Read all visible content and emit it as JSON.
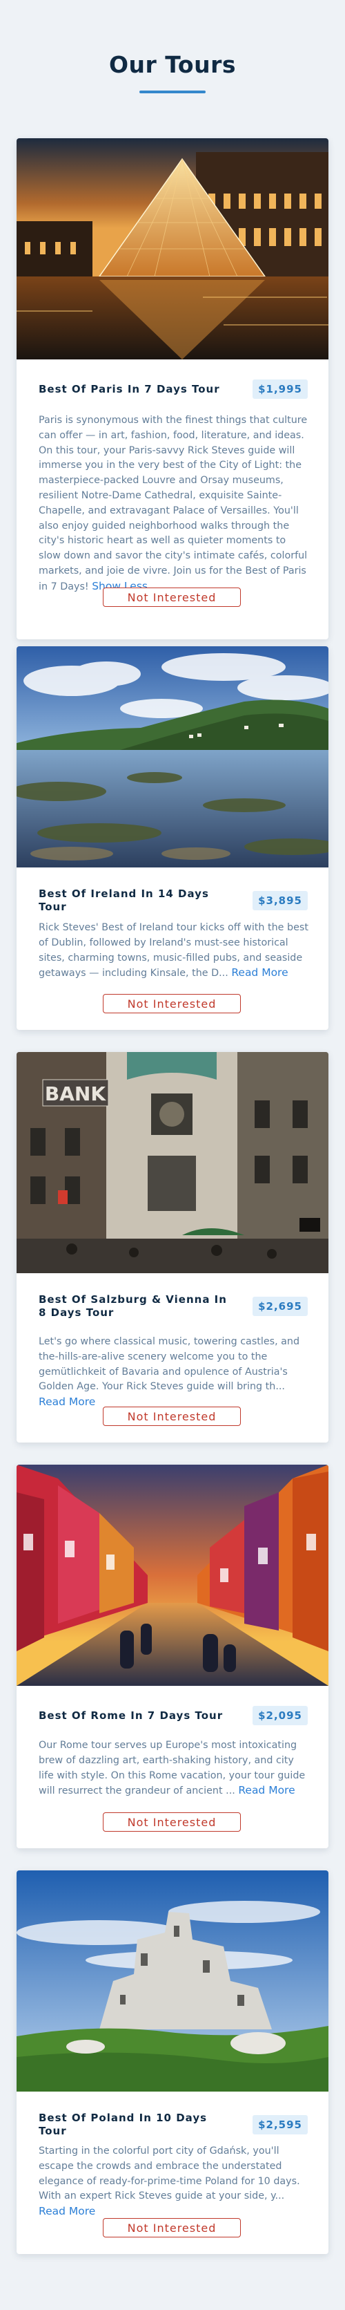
{
  "page": {
    "title": "Our Tours"
  },
  "tours": [
    {
      "name": "Best Of Paris In 7 Days Tour",
      "price": "$1,995",
      "info": "Paris is synonymous with the finest things that culture can offer — in art, fashion, food, literature, and ideas. On this tour, your Paris-savvy Rick Steves guide will immerse you in the very best of the City of Light: the masterpiece-packed Louvre and Orsay museums, resilient Notre-Dame Cathedral, exquisite Sainte-Chapelle, and extravagant Palace of Versailles. You'll also enjoy guided neighborhood walks through the city's historic heart as well as quieter moments to slow down and savor the city's intimate cafés, colorful markets, and joie de vivre. Join us for the Best of Paris in 7 Days!",
      "toggle": "Show Less",
      "button": "Not Interested",
      "image": "louvre-pyramid-photo"
    },
    {
      "name": "Best Of Ireland In 14 Days Tour",
      "price": "$3,895",
      "info": "Rick Steves' Best of Ireland tour kicks off with the best of Dublin, followed by Ireland's must-see historical sites, charming towns, music-filled pubs, and seaside getaways — including Kinsale, the D...",
      "toggle": "Read More",
      "button": "Not Interested",
      "image": "irish-coast-photo"
    },
    {
      "name": "Best Of Salzburg & Vienna In 8 Days Tour",
      "price": "$2,695",
      "info": "Let's go where classical music, towering castles, and the-hills-are-alive scenery welcome you to the gemütlichkeit of Bavaria and opulence of Austria's Golden Age. Your Rick Steves guide will bring th...",
      "toggle": "Read More",
      "button": "Not Interested",
      "image": "vienna-street-photo"
    },
    {
      "name": "Best Of Rome In 7 Days Tour",
      "price": "$2,095",
      "info": "Our Rome tour serves up Europe's most intoxicating brew of dazzling art, earth-shaking history, and city life with style. On this Rome vacation, your tour guide will resurrect the grandeur of ancient ...",
      "toggle": "Read More",
      "button": "Not Interested",
      "image": "burano-canal-photo"
    },
    {
      "name": "Best Of Poland In 10 Days Tour",
      "price": "$2,595",
      "info": "Starting in the colorful port city of Gdańsk, you'll escape the crowds and embrace the understated elegance of ready-for-prime-time Poland for 10 days. With an expert Rick Steves guide at your side, y...",
      "toggle": "Read More",
      "button": "Not Interested",
      "image": "castle-ruins-photo"
    }
  ],
  "image_labels": {
    "bank_sign": "BANK"
  },
  "colors": {
    "accent": "#3488cc",
    "price_bg": "#e1effa",
    "price_text": "#2b7bc0",
    "danger": "#c0392b",
    "link": "#2c7fd6",
    "page_bg": "#eef2f6"
  }
}
